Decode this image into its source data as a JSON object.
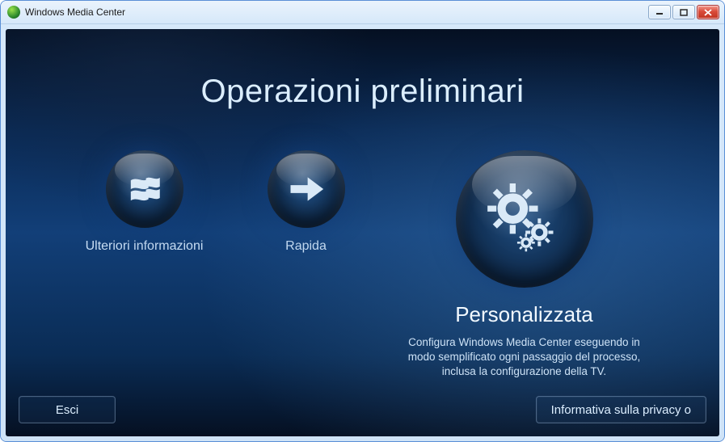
{
  "window": {
    "title": "Windows Media Center"
  },
  "setup": {
    "heading": "Operazioni preliminari",
    "options": {
      "learn_more": {
        "label": "Ulteriori informazioni"
      },
      "quick": {
        "label": "Rapida"
      },
      "custom": {
        "label": "Personalizzata",
        "description": "Configura Windows Media Center eseguendo in modo semplificato ogni passaggio del processo, inclusa la configurazione della TV."
      }
    },
    "buttons": {
      "exit": "Esci",
      "privacy": "Informativa sulla privacy o"
    }
  }
}
